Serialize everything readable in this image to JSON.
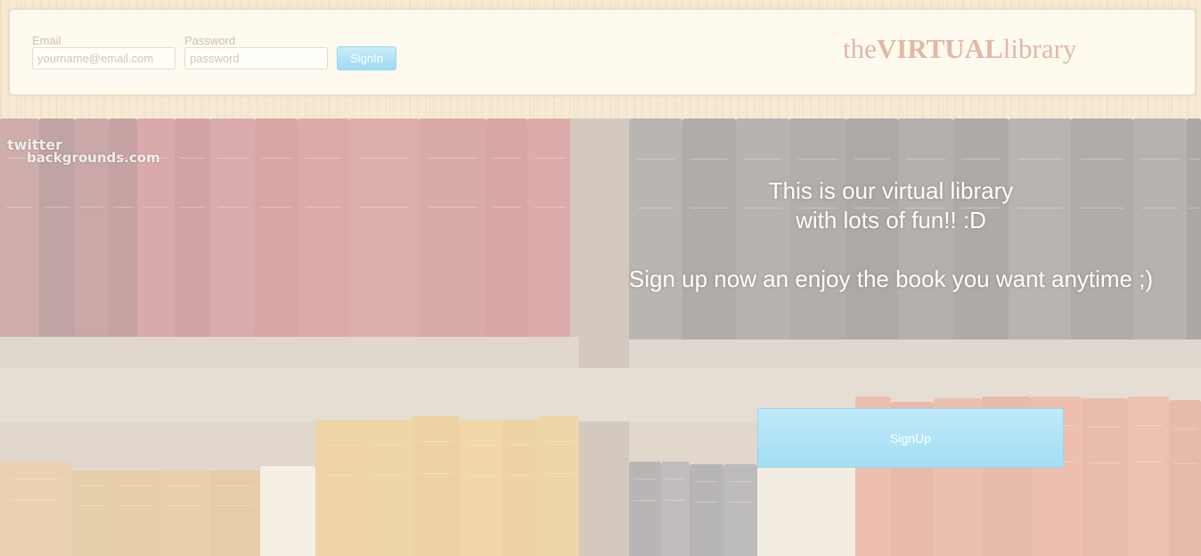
{
  "header": {
    "email_label": "Email",
    "email_placeholder": "yourname@email.com",
    "password_label": "Password",
    "password_placeholder": "password",
    "signin_label": "SignIn",
    "logo": {
      "part1": "the",
      "part2": "VIRTUAL",
      "part3": "library"
    }
  },
  "welcome": {
    "line1": "This is our virtual library",
    "line2": "with lots of fun!! :D",
    "line3": "Sign up now an enjoy the book you want anytime ;)"
  },
  "signup_label": "SignUp",
  "watermark": {
    "line1": "twitter",
    "line2": "backgrounds.com"
  },
  "colors": {
    "logo": "#e0b8a6",
    "button_blue": "#a4def4",
    "wood": "#f7ead3"
  }
}
